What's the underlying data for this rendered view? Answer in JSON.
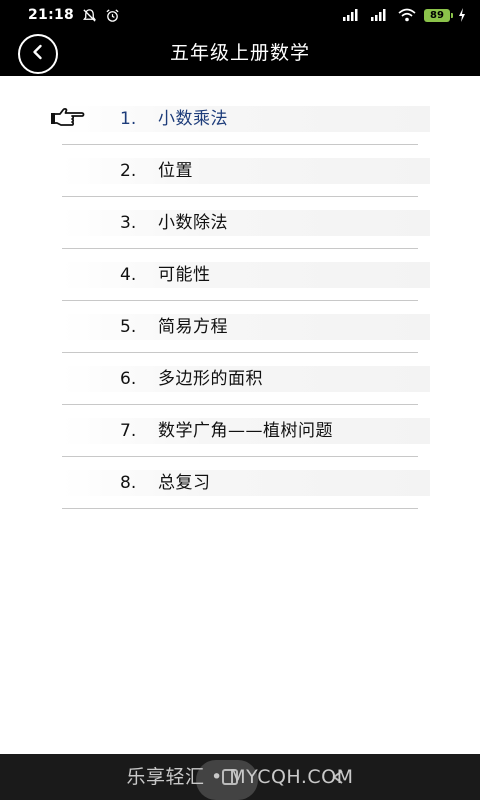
{
  "status_bar": {
    "time": "21:18",
    "battery": "89",
    "icons": [
      "mute-bell-icon",
      "alarm-icon",
      "signal-icon",
      "signal-icon",
      "wifi-icon",
      "battery-icon",
      "charging-icon"
    ]
  },
  "header": {
    "title": "五年级上册数学",
    "back_icon": "chevron-left-icon"
  },
  "chapters": [
    {
      "num": "1.",
      "title": "小数乘法",
      "active": true
    },
    {
      "num": "2.",
      "title": "位置"
    },
    {
      "num": "3.",
      "title": "小数除法"
    },
    {
      "num": "4.",
      "title": "可能性"
    },
    {
      "num": "5.",
      "title": "简易方程"
    },
    {
      "num": "6.",
      "title": "多边形的面积"
    },
    {
      "num": "7.",
      "title": "数学广角——植树问题"
    },
    {
      "num": "8.",
      "title": "总复习"
    }
  ],
  "colors": {
    "bar_background": "#000000",
    "active_text": "#1d3c7a",
    "divider": "#c8c8c8",
    "battery": "#8BC34A"
  },
  "watermark": "乐享轻汇 • MYCQH.COM"
}
